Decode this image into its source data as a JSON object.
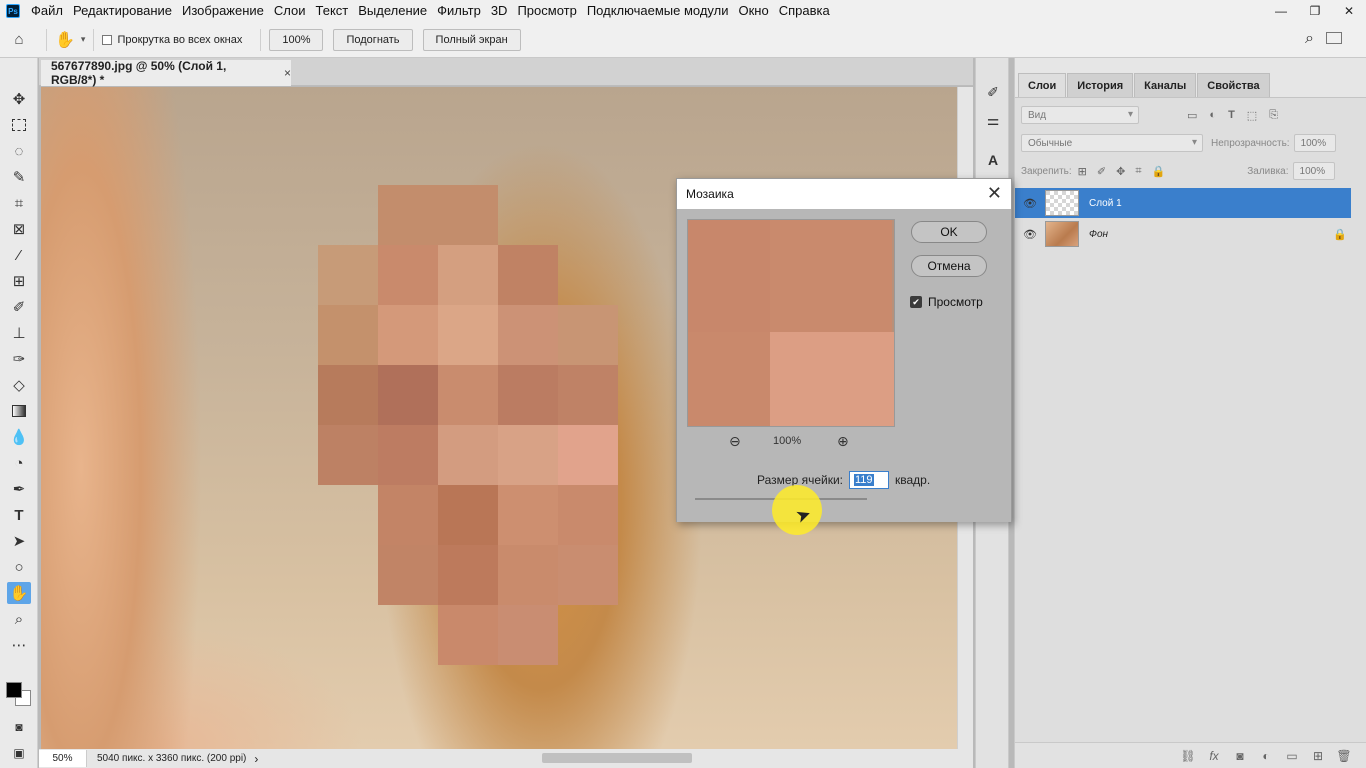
{
  "menubar": {
    "logo": "Ps",
    "items": [
      "Файл",
      "Редактирование",
      "Изображение",
      "Слои",
      "Текст",
      "Выделение",
      "Фильтр",
      "3D",
      "Просмотр",
      "Подключаемые модули",
      "Окно",
      "Справка"
    ]
  },
  "options": {
    "scroll_all_label": "Прокрутка во всех окнах",
    "zoom_100": "100%",
    "fit_label": "Подогнать",
    "fullscreen_label": "Полный экран"
  },
  "document": {
    "tab_title": "567677890.jpg @ 50% (Слой 1, RGB/8*) *",
    "tab_close": "×"
  },
  "status": {
    "zoom": "50%",
    "info": "5040 пикс. x 3360 пикс. (200 ppi)",
    "arrow": "›"
  },
  "panel": {
    "tabs": [
      "Слои",
      "История",
      "Каналы",
      "Свойства"
    ],
    "search_placeholder": "Вид",
    "blend_mode": "Обычные",
    "opacity_label": "Непрозрачность:",
    "opacity_value": "100%",
    "lock_label": "Закрепить:",
    "fill_label": "Заливка:",
    "fill_value": "100%",
    "layers": [
      {
        "name": "Слой 1",
        "selected": true
      },
      {
        "name": "Фон",
        "selected": false
      }
    ]
  },
  "dialog": {
    "title": "Мозаика",
    "ok_label": "OK",
    "cancel_label": "Отмена",
    "preview_label": "Просмотр",
    "zoom_value": "100%",
    "cell_size_label": "Размер ячейки:",
    "cell_size_value": "119",
    "cell_size_unit": "квадр."
  },
  "colors": {
    "accent": "#3a7fcc",
    "cursor_highlight": "#ffec28"
  }
}
